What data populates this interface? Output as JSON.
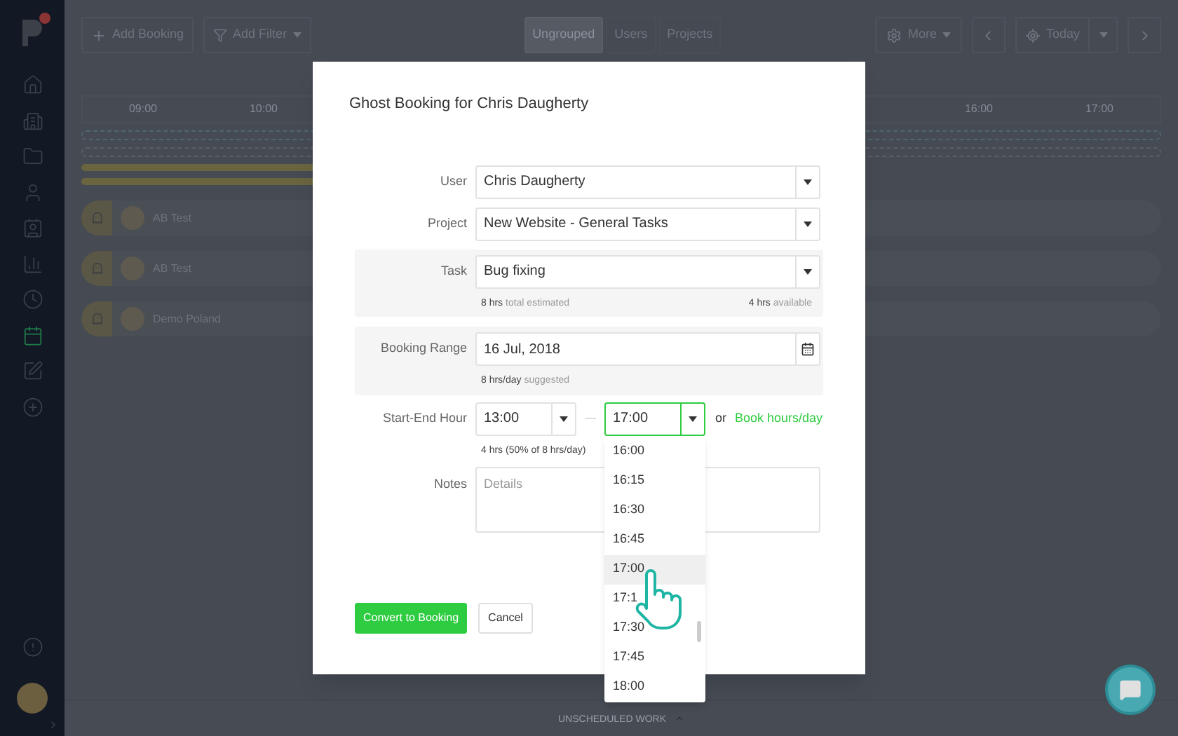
{
  "sidebar": {
    "items": [
      {
        "selected": false
      },
      {
        "selected": false
      },
      {
        "selected": false
      },
      {
        "selected": false
      },
      {
        "selected": false
      },
      {
        "selected": false
      },
      {
        "selected": false
      },
      {
        "selected": true
      },
      {
        "selected": false
      },
      {
        "selected": false
      }
    ]
  },
  "toolbar": {
    "add_booking": "Add Booking",
    "add_filter": "Add Filter",
    "group_tabs": [
      {
        "label": "Ungrouped",
        "selected": true
      },
      {
        "label": "Users",
        "selected": false
      },
      {
        "label": "Projects",
        "selected": false
      }
    ],
    "more": "More",
    "today": "Today"
  },
  "timeline": {
    "hours": [
      "09:00",
      "10:00",
      "16:00",
      "17:00"
    ]
  },
  "rows": [
    {
      "name": "AB Test"
    },
    {
      "name": "AB Test"
    },
    {
      "name": "Demo Poland"
    }
  ],
  "footer": "UNSCHEDULED WORK",
  "modal": {
    "title": "Ghost Booking for Chris Daugherty",
    "user": {
      "label": "User",
      "value": "Chris Daugherty"
    },
    "project": {
      "label": "Project",
      "value": "New Website - General Tasks"
    },
    "task": {
      "label": "Task",
      "value": "Bug fixing",
      "estimated": "**8 hrs** total estimated",
      "available": "**4 hrs** available"
    },
    "booking_range": {
      "label": "Booking Range",
      "value": "16 Jul, 2018",
      "hint": "**8 hrs/day** suggested"
    },
    "hours": {
      "label": "Start-End Hour",
      "start": "13:00",
      "end": "17:00",
      "expanded": true,
      "or_text": "or",
      "link": "Book hours/day",
      "hint": "4 hrs (50% of 8 hrs/day)"
    },
    "notes": {
      "label": "Notes",
      "placeholder": "Details"
    },
    "convert_button": "Convert to Booking",
    "cancel_button": "Cancel",
    "options": [
      {
        "label": "16:00",
        "selected": false
      },
      {
        "label": "16:15",
        "selected": false
      },
      {
        "label": "16:30",
        "selected": false
      },
      {
        "label": "16:45",
        "selected": false
      },
      {
        "label": "17:00",
        "selected": true
      },
      {
        "label": "17:1",
        "selected": false
      },
      {
        "label": "17:30",
        "selected": false
      },
      {
        "label": "17:45",
        "selected": false
      },
      {
        "label": "18:00",
        "selected": false
      }
    ]
  }
}
